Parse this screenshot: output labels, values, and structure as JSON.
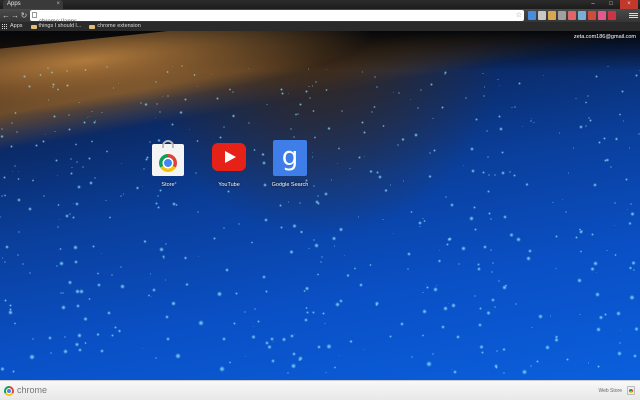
{
  "tab": {
    "title": "Apps",
    "close_icon": "close-icon"
  },
  "window": {
    "minimize": "–",
    "maximize": "□",
    "close": "×"
  },
  "toolbar": {
    "back": "←",
    "forward": "→",
    "reload": "↻",
    "url": "chrome://apps",
    "extensions": [
      "#4a8de0",
      "#c8c8c8",
      "#d9a84e",
      "#a0a0a0",
      "#e06666",
      "#7aaed8",
      "#d24b3a",
      "#e35a8a",
      "#cc3344"
    ]
  },
  "bookmarks": [
    {
      "label": "Apps",
      "icon": "apps-grid-icon"
    },
    {
      "label": "things I should l...",
      "icon": "folder-icon"
    },
    {
      "label": "chrome extension",
      "icon": "folder-icon"
    }
  ],
  "user": {
    "email": "zeta.com186@gmail.com"
  },
  "apps": [
    {
      "label": "Store",
      "icon": "web-store-icon"
    },
    {
      "label": "YouTube",
      "icon": "youtube-icon"
    },
    {
      "label": "Google Search",
      "icon": "google-search-icon"
    }
  ],
  "footer": {
    "brand": "chrome",
    "webstore_label": "Web Store"
  }
}
